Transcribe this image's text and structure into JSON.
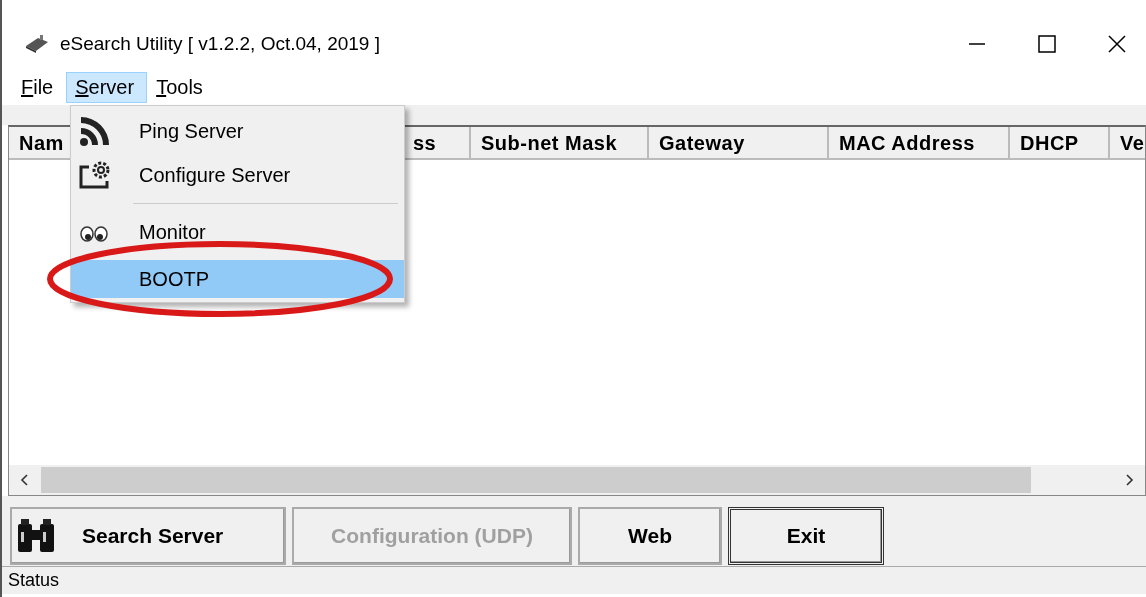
{
  "window": {
    "title": "eSearch Utility [ v1.2.2, Oct.04, 2019 ]"
  },
  "menubar": [
    {
      "label": "File",
      "selected": false
    },
    {
      "label": "Server",
      "selected": true
    },
    {
      "label": "Tools",
      "selected": false
    }
  ],
  "menu": [
    {
      "kind": "signal",
      "label": "Ping Server",
      "selected": false
    },
    {
      "kind": "gear",
      "label": "Configure Server",
      "selected": false
    },
    {
      "kind": "separator"
    },
    {
      "kind": "eyes",
      "label": "Monitor",
      "selected": false
    },
    {
      "kind": "plain",
      "label": "BOOTP",
      "selected": true
    }
  ],
  "table": {
    "columns": [
      "Nam",
      "ss",
      "Sub-net Mask",
      "Gateway",
      "MAC Address",
      "DHCP",
      "Ve"
    ]
  },
  "buttons": [
    {
      "label": "Search Server",
      "icon": true,
      "disabled": false,
      "default": false
    },
    {
      "label": "Configuration (UDP)",
      "icon": false,
      "disabled": true,
      "default": false
    },
    {
      "label": "Web",
      "icon": false,
      "disabled": false,
      "default": false
    },
    {
      "label": "Exit",
      "icon": false,
      "disabled": false,
      "default": true
    }
  ],
  "status_bar": "Status"
}
